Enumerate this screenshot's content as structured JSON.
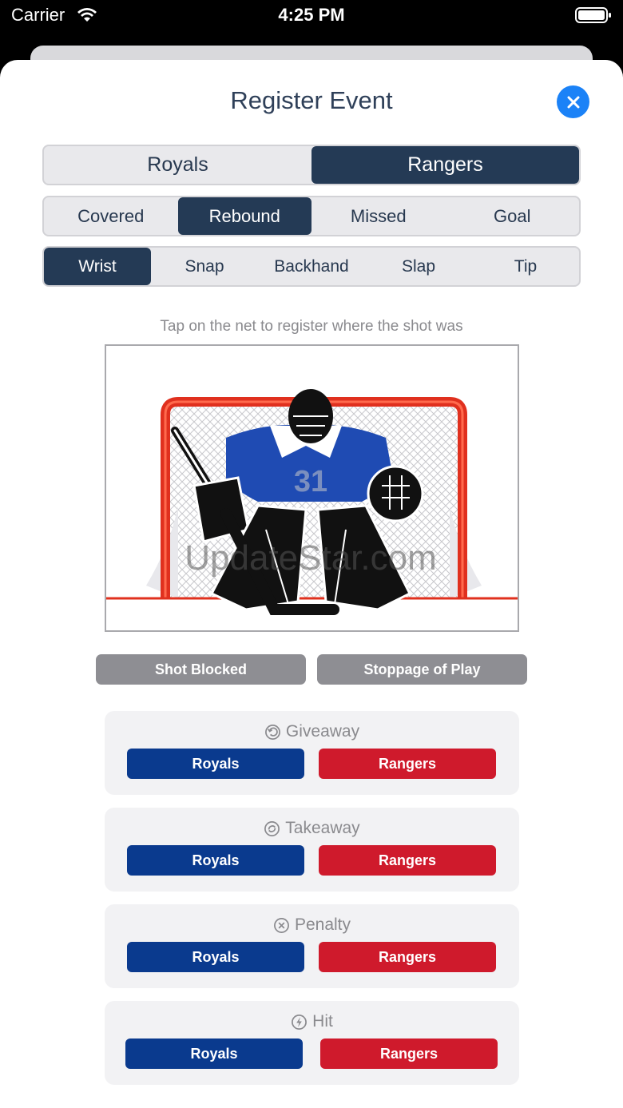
{
  "status": {
    "carrier": "Carrier",
    "time": "4:25 PM"
  },
  "title": "Register Event",
  "teams": [
    "Royals",
    "Rangers"
  ],
  "selected_team": "Rangers",
  "results": [
    "Covered",
    "Rebound",
    "Missed",
    "Goal"
  ],
  "selected_result": "Rebound",
  "shot_types": [
    "Wrist",
    "Snap",
    "Backhand",
    "Slap",
    "Tip"
  ],
  "selected_shot_type": "Wrist",
  "hint": "Tap on the net to register where the shot was",
  "net_image": {
    "jersey_number": "31",
    "watermark": "UpdateStar.com"
  },
  "actions": {
    "shot_blocked": "Shot Blocked",
    "stoppage": "Stoppage of Play"
  },
  "events": [
    {
      "label": "Giveaway",
      "icon": "giveaway-icon",
      "team_a": "Royals",
      "team_b": "Rangers"
    },
    {
      "label": "Takeaway",
      "icon": "takeaway-icon",
      "team_a": "Royals",
      "team_b": "Rangers"
    },
    {
      "label": "Penalty",
      "icon": "penalty-icon",
      "team_a": "Royals",
      "team_b": "Rangers"
    },
    {
      "label": "Hit",
      "icon": "hit-icon",
      "team_a": "Royals",
      "team_b": "Rangers"
    }
  ],
  "colors": {
    "accent": "#1b82f7",
    "selected": "#243a55",
    "team_a": "#0a3a8e",
    "team_b": "#cf1a2c",
    "action_gray": "#8e8e93"
  }
}
